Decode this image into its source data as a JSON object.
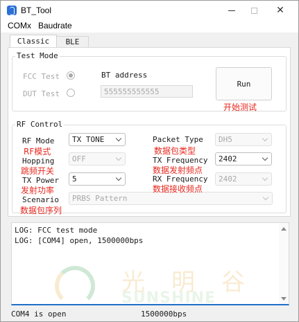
{
  "window": {
    "title": "BT_Tool"
  },
  "menu": {
    "items": [
      "COMx",
      "Baudrate"
    ]
  },
  "tabs": {
    "classic": "Classic",
    "ble": "BLE"
  },
  "test_mode": {
    "label": "Test Mode",
    "fcc_test": "FCC Test",
    "dut_test": "DUT Test",
    "selected": "FCC Test",
    "bt_address_label": "BT address",
    "bt_address_value": "555555555555",
    "run_button": "Run",
    "run_annotation": "开始测试"
  },
  "rf_control": {
    "label": "RF Control",
    "rf_mode": {
      "label": "RF Mode",
      "value": "TX TONE",
      "annotation": "RF模式"
    },
    "hopping": {
      "label": "Hopping",
      "value": "OFF",
      "annotation": "跳频开关"
    },
    "tx_power": {
      "label": "TX Power",
      "value": "5",
      "annotation": "发射功率"
    },
    "scenario": {
      "label": "Scenario",
      "value": "PRBS Pattern",
      "annotation": "数据包序列"
    },
    "packet_type": {
      "label": "Packet Type",
      "value": "DH5",
      "annotation": "数据包类型"
    },
    "tx_frequency": {
      "label": "TX Frequency",
      "value": "2402",
      "annotation": "数据发射频点"
    },
    "rx_frequency": {
      "label": "RX Frequency",
      "value": "2402",
      "annotation": "数据接收频点"
    }
  },
  "log": {
    "lines": [
      "LOG: FCC test mode",
      "LOG: [COM4] open, 1500000bps"
    ],
    "watermark_cn": "光明谷",
    "watermark_en": "SUNSHINE SILICON"
  },
  "status": {
    "port": "COM4 is open",
    "baud": "1500000bps"
  },
  "colors": {
    "annotation": "#e8281e",
    "accent": "#1d6fc9"
  }
}
